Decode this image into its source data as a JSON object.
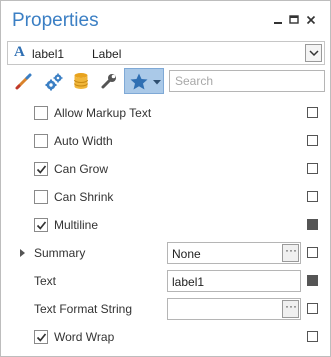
{
  "header": {
    "title": "Properties",
    "pin_icon": "pin-icon",
    "maximize_icon": "maximize-icon",
    "close_icon": "close-icon"
  },
  "selector": {
    "icon": "label-a-icon",
    "icon_glyph": "A",
    "name": "label1",
    "type": "Label"
  },
  "toolbar": {
    "buttons": [
      "appearance-brush-icon",
      "behavior-gears-icon",
      "data-database-icon",
      "layout-wrench-icon",
      "favorites-star-icon"
    ],
    "search_placeholder": "Search"
  },
  "properties": [
    {
      "kind": "checkbox",
      "label": "Allow Markup Text",
      "checked": false,
      "marker_set": false
    },
    {
      "kind": "checkbox",
      "label": "Auto Width",
      "checked": false,
      "marker_set": false
    },
    {
      "kind": "checkbox",
      "label": "Can Grow",
      "checked": true,
      "marker_set": false
    },
    {
      "kind": "checkbox",
      "label": "Can Shrink",
      "checked": false,
      "marker_set": false
    },
    {
      "kind": "checkbox",
      "label": "Multiline",
      "checked": true,
      "marker_set": true
    },
    {
      "kind": "editor",
      "label": "Summary",
      "value": "None",
      "expandable": true,
      "ellipsis": true,
      "marker_set": false
    },
    {
      "kind": "editor",
      "label": "Text",
      "value": "label1",
      "expandable": false,
      "ellipsis": false,
      "marker_set": true
    },
    {
      "kind": "editor",
      "label": "Text Format String",
      "value": "",
      "expandable": false,
      "ellipsis": true,
      "marker_set": false
    },
    {
      "kind": "checkbox",
      "label": "Word Wrap",
      "checked": true,
      "marker_set": false
    }
  ],
  "colors": {
    "title": "#3b7fc4",
    "active_tab": "#aac9e8",
    "marker_set": "#555555"
  }
}
